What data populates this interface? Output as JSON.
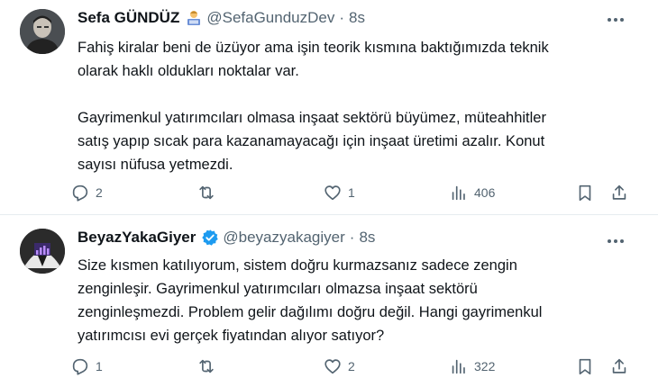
{
  "tweets": [
    {
      "author_name": "Sefa GÜNDÜZ",
      "author_emoji": "technologist-emoji",
      "handle": "@SefaGunduzDev",
      "separator": "·",
      "time": "8s",
      "text": "Fahiş kiralar beni de üzüyor ama işin teorik kısmına baktığımızda teknik\nolarak haklı oldukları noktalar var.\n\nGayrimenkul yatırımcıları olmasa inşaat sektörü büyümez, müteahhitler\nsatış yapıp sıcak para kazanamayacağı için inşaat üretimi azalır. Konut\nsayısı nüfusa yetmezdi.",
      "replies": "2",
      "retweets": "",
      "likes": "1",
      "views": "406"
    },
    {
      "author_name": "BeyazYakaGiyer",
      "verified": true,
      "handle": "@beyazyakagiyer",
      "separator": "·",
      "time": "8s",
      "text": "Size kısmen katılıyorum, sistem doğru kurmazsanız sadece zengin\nzenginleşir.  Gayrimenkul yatırımcıları olmazsa inşaat sektörü\nzenginleşmezdi. Problem gelir dağılımı doğru değil. Hangi gayrimenkul\nyatırımcısı evi gerçek fiyatından alıyor satıyor?",
      "replies": "1",
      "retweets": "",
      "likes": "2",
      "views": "322"
    }
  ],
  "colors": {
    "text": "#0f1419",
    "muted": "#536471",
    "verified": "#1d9bf0",
    "divider": "#e6ecf0"
  }
}
